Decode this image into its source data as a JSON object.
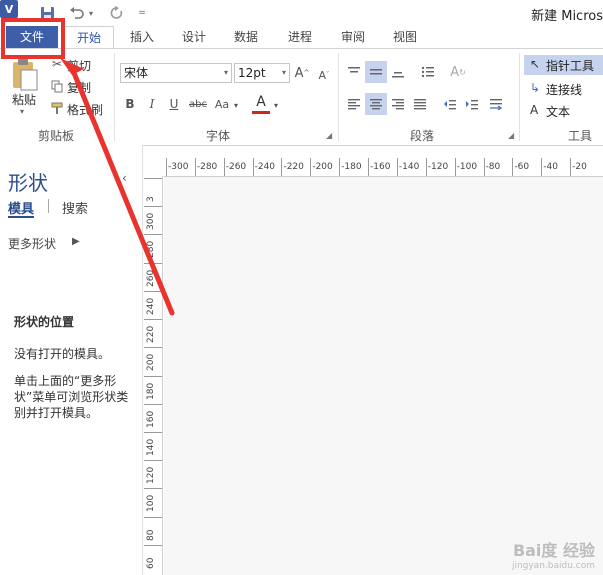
{
  "titlebar": {
    "app_icon": "V",
    "doc_title": "新建 Micros"
  },
  "quick_access": {
    "save_icon": "save-icon",
    "undo_icon": "undo-icon",
    "redo_icon": "redo-icon"
  },
  "tabs": [
    {
      "label": "文件"
    },
    {
      "label": "开始"
    },
    {
      "label": "插入"
    },
    {
      "label": "设计"
    },
    {
      "label": "数据"
    },
    {
      "label": "进程"
    },
    {
      "label": "审阅"
    },
    {
      "label": "视图"
    }
  ],
  "ribbon": {
    "clipboard": {
      "paste": "粘贴",
      "cut": "剪切",
      "copy": "复制",
      "format_painter": "格式刷",
      "group": "剪贴板"
    },
    "font": {
      "family": "宋体",
      "size": "12pt",
      "grow": "A",
      "shrink": "A",
      "bold": "B",
      "italic": "I",
      "underline": "U",
      "strike": "abc",
      "case": "Aa",
      "color": "A",
      "group": "字体"
    },
    "paragraph": {
      "group": "段落"
    },
    "tools": {
      "pointer": "指针工具",
      "connector": "连接线",
      "text": "文本",
      "text_glyph": "A",
      "group": "工具"
    }
  },
  "shapes_pane": {
    "title": "形状",
    "tab_stencils": "模具",
    "tab_search": "搜索",
    "more_shapes": "更多形状",
    "location_heading": "形状的位置",
    "no_stencils": "没有打开的模具。",
    "instructions": "单击上面的“更多形状”菜单可浏览形状类别并打开模具。"
  },
  "ruler": {
    "h_labels": [
      "-300",
      "-280",
      "-260",
      "-240",
      "-220",
      "-200",
      "-180",
      "-160",
      "-140",
      "-120",
      "-100",
      "-80",
      "-60",
      "-40",
      "-20"
    ],
    "v_labels": [
      "3",
      "300",
      "280",
      "260",
      "240",
      "220",
      "200",
      "180",
      "160",
      "140",
      "120",
      "100",
      "80",
      "60"
    ]
  },
  "watermark": {
    "brand": "Bai度 经验",
    "url": "jingyan.baidu.com"
  },
  "colors": {
    "file_tab": "#3e5fa8",
    "highlight": "#e8332f",
    "accent": "#2b4d8e"
  }
}
